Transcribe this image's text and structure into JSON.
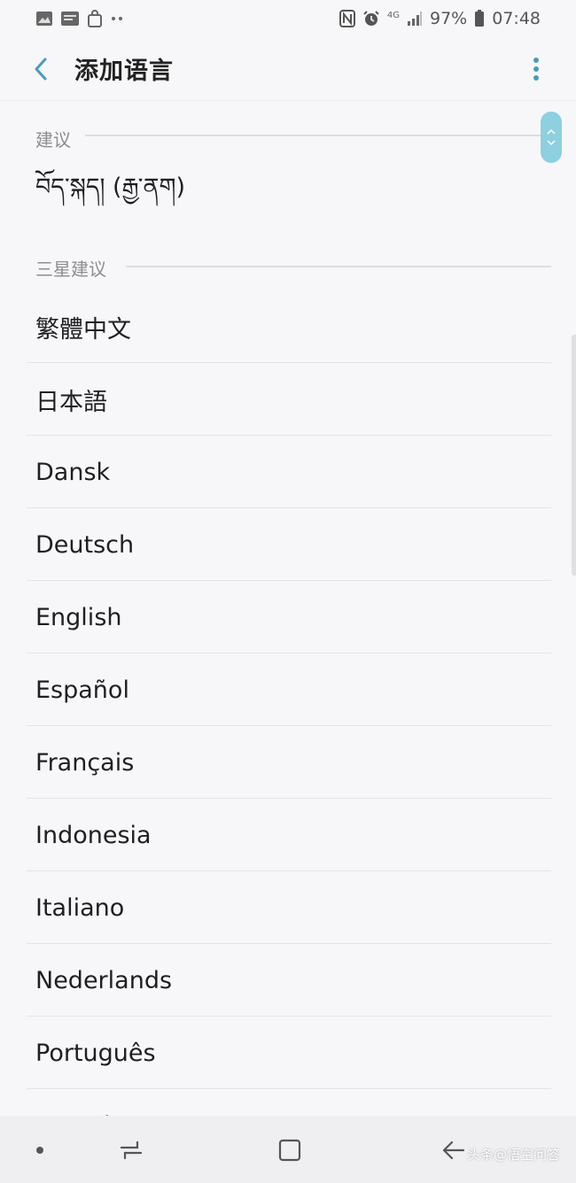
{
  "status_bar": {
    "battery": "97%",
    "time": "07:48",
    "network": "4G",
    "icons": [
      "gallery-icon",
      "photo-icon",
      "bag-icon",
      "more-dots-icon",
      "nfc-icon",
      "alarm-icon",
      "signal-icon",
      "battery-icon"
    ]
  },
  "app_bar": {
    "title": "添加语言",
    "back_icon": "chevron-left-icon",
    "more_icon": "more-vert-icon"
  },
  "sections": {
    "suggested": {
      "label": "建议",
      "items": [
        "བོད་སྐད། (རྒྱ་ནག)"
      ]
    },
    "samsung_suggested": {
      "label": "三星建议",
      "items": [
        "繁體中文",
        "日本語",
        "Dansk",
        "Deutsch",
        "English",
        "Español",
        "Français",
        "Indonesia",
        "Italiano",
        "Nederlands",
        "Português",
        "Suomi"
      ]
    }
  },
  "nav_bar": {
    "icons": [
      "dot-icon",
      "recents-icon",
      "home-icon",
      "back-arrow-icon"
    ]
  },
  "watermark": "头条@悟空问答",
  "colors": {
    "accent": "#4a9bb8",
    "fast_scroll": "#8ecfe0",
    "background": "#f7f7f9",
    "nav_background": "#efeff1"
  }
}
